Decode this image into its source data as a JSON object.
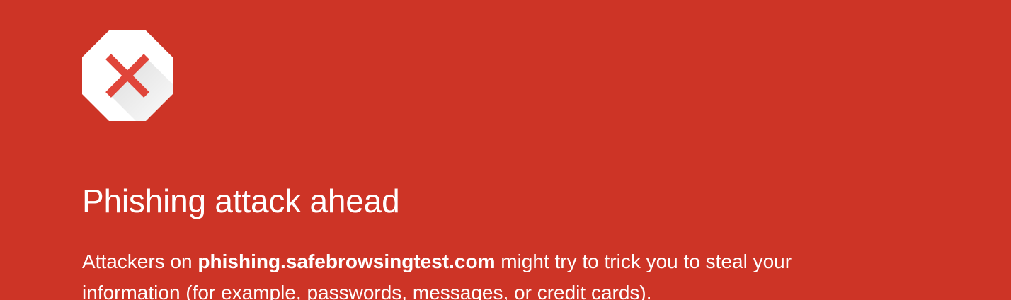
{
  "interstitial": {
    "icon": "stop-x-octagon-icon",
    "heading": "Phishing attack ahead",
    "explanation": {
      "before_domain": "Attackers on ",
      "domain": "phishing.safebrowsingtest.com",
      "after_domain": " might try to trick you to steal your information (for example, passwords, messages, or credit cards)."
    }
  },
  "colors": {
    "background": "#cd3426",
    "icon_fill": "#ffffff",
    "icon_x": "#e0453a",
    "text": "#ffffff"
  }
}
